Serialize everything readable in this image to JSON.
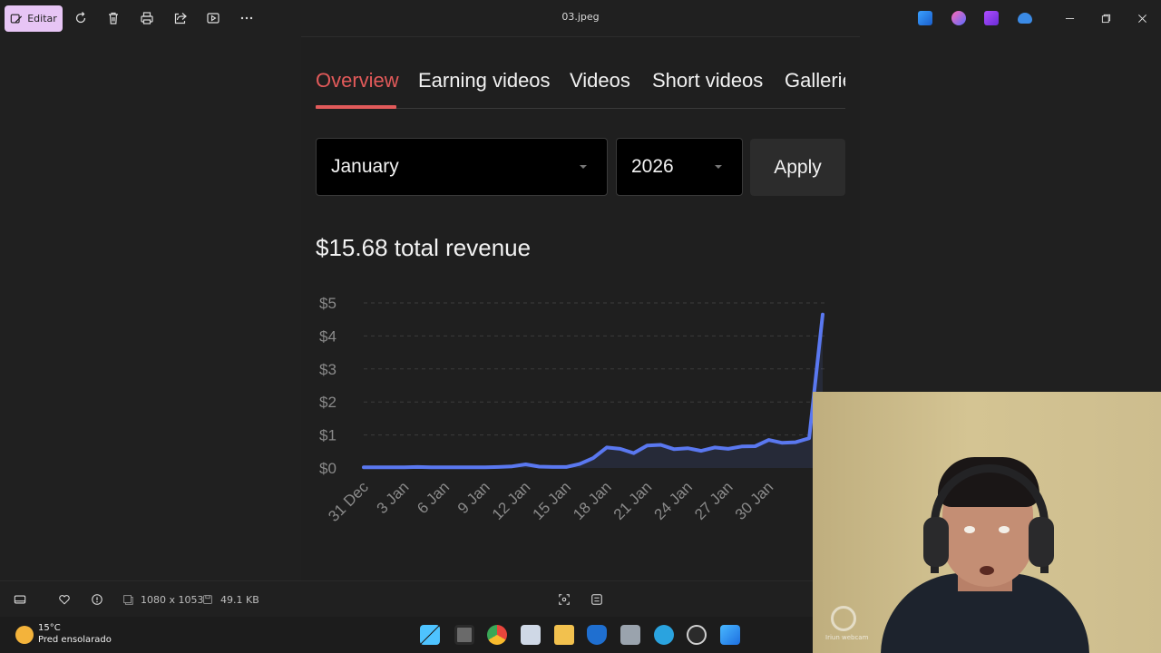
{
  "titlebar": {
    "edit_label": "Editar",
    "file_name": "03.jpeg",
    "tool_icons": [
      "rotate-icon",
      "delete-icon",
      "print-icon",
      "share-icon",
      "slideshow-icon",
      "more-icon"
    ],
    "app_icons": [
      "photos-app-icon",
      "designer-app-icon",
      "clipchamp-app-icon",
      "onedrive-icon"
    ],
    "window_buttons": [
      "minimize-icon",
      "restore-icon",
      "close-icon"
    ]
  },
  "page": {
    "tabs": [
      {
        "label": "Overview",
        "active": true
      },
      {
        "label": "Earning videos",
        "active": false
      },
      {
        "label": "Videos",
        "active": false
      },
      {
        "label": "Short videos",
        "active": false
      },
      {
        "label": "Gallerie",
        "active": false
      }
    ],
    "month_select": "January",
    "year_select": "2026",
    "apply_label": "Apply",
    "total_revenue": "$15.68 total revenue"
  },
  "colors": {
    "accent_tab": "#e25a5a",
    "series_line": "#5a78f0",
    "background": "#1f1f1f"
  },
  "chart_data": {
    "type": "line",
    "title": "",
    "xlabel": "",
    "ylabel": "",
    "ylim": [
      0,
      5
    ],
    "y_ticks": [
      "$0",
      "$1",
      "$2",
      "$3",
      "$4",
      "$5"
    ],
    "x_ticks": [
      "31 Dec",
      "3 Jan",
      "6 Jan",
      "9 Jan",
      "12 Jan",
      "15 Jan",
      "18 Jan",
      "21 Jan",
      "24 Jan",
      "27 Jan",
      "30 Jan"
    ],
    "grid": true,
    "series": [
      {
        "values": [
          0.02,
          0.02,
          0.02,
          0.02,
          0.03,
          0.02,
          0.02,
          0.02,
          0.02,
          0.02,
          0.03,
          0.05,
          0.11,
          0.04,
          0.03,
          0.03,
          0.12,
          0.3,
          0.62,
          0.58,
          0.45,
          0.68,
          0.7,
          0.57,
          0.6,
          0.52,
          0.62,
          0.58,
          0.65,
          0.66,
          0.85,
          0.76,
          0.78,
          0.9,
          4.65
        ]
      }
    ]
  },
  "statusbar": {
    "dimensions": "1080 x 1053",
    "file_size": "49.1 KB",
    "icons": [
      "filmstrip-icon",
      "favorite-icon",
      "info-icon",
      "dimensions-icon",
      "file-size-icon",
      "fit-to-window-icon",
      "actual-size-icon"
    ]
  },
  "taskbar": {
    "temperature": "15°C",
    "weather": "Pred ensolarado",
    "apps": [
      "start-icon",
      "task-view-icon",
      "chrome-icon",
      "snipping-tool-icon",
      "file-explorer-icon",
      "defender-icon",
      "calculator-icon",
      "telegram-icon",
      "obs-icon",
      "photos-icon"
    ]
  },
  "webcam": {
    "watermark": "Iriun webcam"
  }
}
